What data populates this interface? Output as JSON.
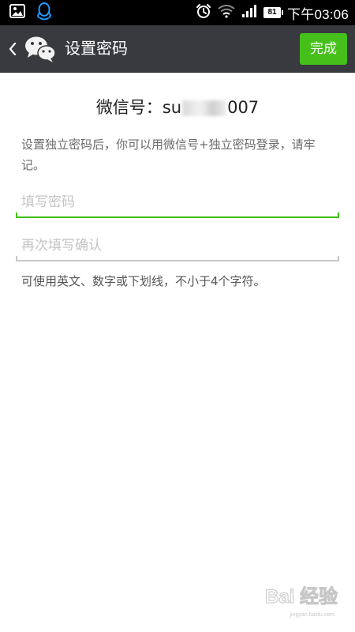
{
  "status_bar": {
    "time": "下午03:06",
    "battery": "81",
    "left_icons": [
      "gallery-icon",
      "qq-icon"
    ],
    "right_icons": [
      "alarm-icon",
      "wifi-icon",
      "signal-icon",
      "battery-icon"
    ]
  },
  "action_bar": {
    "title": "设置密码",
    "done_label": "完成",
    "background": "#393a3f",
    "done_color": "#45c01a"
  },
  "account": {
    "label": "微信号：",
    "id_prefix": "su",
    "id_suffix": "007"
  },
  "hint_top": "设置独立密码后，你可以用微信号+独立密码登录，请牢记。",
  "fields": {
    "password": {
      "placeholder": "填写密码",
      "value": ""
    },
    "confirm": {
      "placeholder": "再次填写确认",
      "value": ""
    }
  },
  "hint_bottom": "可使用英文、数字或下划线，不小于4个字符。",
  "watermark": {
    "text": "Bai 经验",
    "url": "jingyan.baidu.com"
  },
  "colors": {
    "accent": "#45c01a",
    "hint_text": "#6b6b6b",
    "placeholder": "#c4c4c4",
    "inactive_line": "#c8c8c8"
  }
}
